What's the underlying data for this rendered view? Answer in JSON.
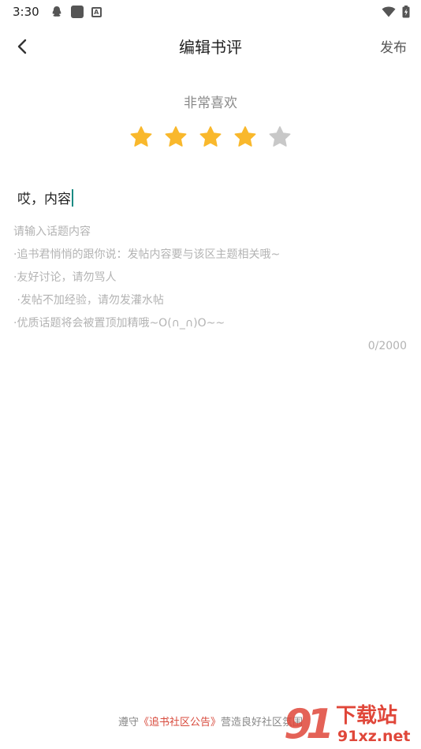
{
  "status_bar": {
    "time": "3:30"
  },
  "header": {
    "title": "编辑书评",
    "publish_label": "发布"
  },
  "rating": {
    "label": "非常喜欢",
    "value": 4,
    "max": 5,
    "active_color": "#F9B82C",
    "inactive_color": "#C8C8C8"
  },
  "editor": {
    "title_value": "哎，内容",
    "placeholder_lines": [
      "请输入话题内容",
      "·追书君悄悄的跟你说：发帖内容要与该区主题相关哦~",
      "·友好讨论，请勿骂人",
      " ·发帖不加经验，请勿发灌水帖",
      "·优质话题将会被置顶加精哦~O(∩_∩)O~~"
    ],
    "counter": "0/2000"
  },
  "footer": {
    "prefix": "遵守",
    "link": "《追书社区公告》",
    "suffix": "营造良好社区氛围"
  },
  "watermark": {
    "text_top": "下载站",
    "text_bottom": "91xz.net"
  }
}
